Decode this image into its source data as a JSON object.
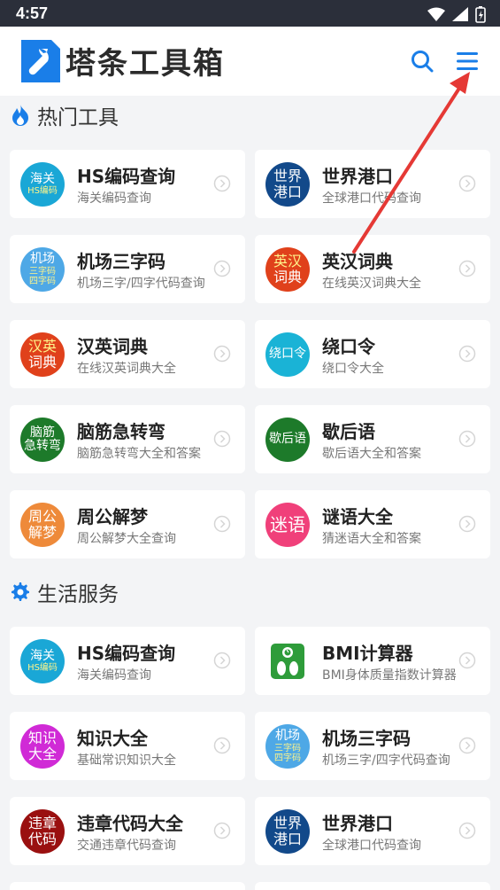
{
  "status": {
    "time": "4:57"
  },
  "header": {
    "app_name": "塔条工具箱"
  },
  "colors": {
    "accent": "#1a7ee8",
    "arrow": "#e53935"
  },
  "sections": [
    {
      "title": "热门工具"
    },
    {
      "title": "生活服务"
    }
  ],
  "hot": [
    {
      "badge_l1": "海关",
      "badge_l2": "HS编码",
      "title": "HS编码查询",
      "sub": "海关编码查询",
      "color": "#1aa7d6"
    },
    {
      "badge_l1": "世界",
      "badge_l2": "港口",
      "title": "世界港口",
      "sub": "全球港口代码查询",
      "color": "#12498a"
    },
    {
      "badge_l1": "机场",
      "badge_l2": "三字码",
      "badge_l3": "四字码",
      "title": "机场三字码",
      "sub": "机场三字/四字代码查询",
      "color": "#4ea8e6"
    },
    {
      "badge_l1": "英汉",
      "badge_l2": "词典",
      "title": "英汉词典",
      "sub": "在线英汉词典大全",
      "color": "#e0411b"
    },
    {
      "badge_l1": "汉英",
      "badge_l2": "词典",
      "title": "汉英词典",
      "sub": "在线汉英词典大全",
      "color": "#e0411b"
    },
    {
      "badge_l1": "绕口令",
      "badge_l2": "",
      "title": "绕口令",
      "sub": "绕口令大全",
      "color": "#1ab3d6"
    },
    {
      "badge_l1": "脑筋",
      "badge_l2": "急转弯",
      "title": "脑筋急转弯",
      "sub": "脑筋急转弯大全和答案",
      "color": "#1d7a2a"
    },
    {
      "badge_l1": "歇后语",
      "badge_l2": "",
      "title": "歇后语",
      "sub": "歇后语大全和答案",
      "color": "#1d7a2a"
    },
    {
      "badge_l1": "周公",
      "badge_l2": "解梦",
      "title": "周公解梦",
      "sub": "周公解梦大全查询",
      "color": "#ee8a3a"
    },
    {
      "badge_l1": "迷语",
      "badge_l2": "",
      "title": "谜语大全",
      "sub": "猜迷语大全和答案",
      "color": "#f0407a"
    }
  ],
  "life": [
    {
      "badge_l1": "海关",
      "badge_l2": "HS编码",
      "title": "HS编码查询",
      "sub": "海关编码查询",
      "color": "#1aa7d6"
    },
    {
      "badge_l1": "",
      "badge_l2": "",
      "title": "BMI计算器",
      "sub": "BMI身体质量指数计算器",
      "color": "#2e9c3a"
    },
    {
      "badge_l1": "知识",
      "badge_l2": "大全",
      "title": "知识大全",
      "sub": "基础常识知识大全",
      "color": "#d02ad6"
    },
    {
      "badge_l1": "机场",
      "badge_l2": "三字码",
      "badge_l3": "四字码",
      "title": "机场三字码",
      "sub": "机场三字/四字代码查询",
      "color": "#4ea8e6"
    },
    {
      "badge_l1": "违章",
      "badge_l2": "代码",
      "title": "违章代码大全",
      "sub": "交通违章代码查询",
      "color": "#9a1010"
    },
    {
      "badge_l1": "世界",
      "badge_l2": "港口",
      "title": "世界港口",
      "sub": "全球港口代码查询",
      "color": "#12498a"
    }
  ]
}
